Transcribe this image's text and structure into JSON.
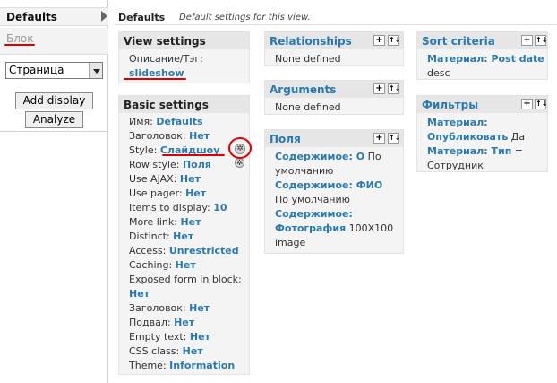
{
  "sidebar": {
    "tab_defaults": "Defaults",
    "tab_block": "Блок",
    "display_select_value": "Страница",
    "add_display_label": "Add display",
    "analyze_label": "Analyze"
  },
  "header": {
    "title": "Defaults",
    "description": "Default settings for this view."
  },
  "view_settings": {
    "title": "View settings",
    "desc_label": "Описание/Тэг:",
    "desc_value": "slideshow"
  },
  "basic_settings": {
    "title": "Basic settings",
    "rows": [
      {
        "label": "Имя:",
        "value": "Defaults"
      },
      {
        "label": "Заголовок:",
        "value": "Нет"
      },
      {
        "label": "Style:",
        "value": "Слайдшоу"
      },
      {
        "label": "Row style:",
        "value": "Поля"
      },
      {
        "label": "Use AJAX:",
        "value": "Нет"
      },
      {
        "label": "Use pager:",
        "value": "Нет"
      },
      {
        "label": "Items to display:",
        "value": "10"
      },
      {
        "label": "More link:",
        "value": "Нет"
      },
      {
        "label": "Distinct:",
        "value": "Нет"
      },
      {
        "label": "Access:",
        "value": "Unrestricted"
      },
      {
        "label": "Caching:",
        "value": "Нет"
      },
      {
        "label": "Exposed form in block:",
        "value": "Нет"
      },
      {
        "label": "Заголовок:",
        "value": "Нет"
      },
      {
        "label": "Подвал:",
        "value": "Нет"
      },
      {
        "label": "Empty text:",
        "value": "Нет"
      },
      {
        "label": "CSS class:",
        "value": "Нет"
      },
      {
        "label": "Theme:",
        "value": "Information"
      }
    ]
  },
  "relationships": {
    "title": "Relationships",
    "empty": "None defined"
  },
  "arguments": {
    "title": "Arguments",
    "empty": "None defined"
  },
  "fields": {
    "title": "Поля",
    "items": [
      {
        "link": "Содержимое: О",
        "rest": " По умолчанию"
      },
      {
        "link": "Содержимое: ФИО",
        "rest": " По умолчанию"
      },
      {
        "link": "Содержимое: Фотография",
        "rest": " 100X100 image"
      }
    ]
  },
  "sort": {
    "title": "Sort criteria",
    "item_link": "Материал: Post date",
    "item_rest": "desc"
  },
  "filters": {
    "title": "Фильтры",
    "items": [
      {
        "link": "Материал: Опубликовать",
        "rest": " Да"
      },
      {
        "link": "Материал: Тип",
        "rest": " = Сотрудник"
      }
    ]
  },
  "toolbar": {
    "add": "+",
    "rearrange": "↑↓",
    "gear": "✲"
  },
  "colors": {
    "link": "#2a7ab0",
    "annotation": "#e00000"
  }
}
